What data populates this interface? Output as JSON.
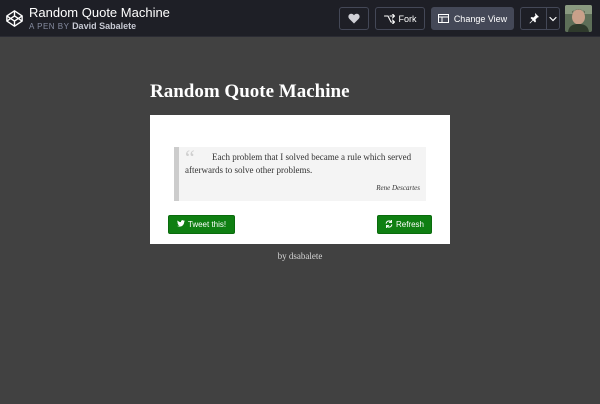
{
  "header": {
    "title": "Random Quote Machine",
    "by_label": "A PEN BY",
    "author": "David Sabalete",
    "fork_label": "Fork",
    "change_view_label": "Change View",
    "icons": {
      "logo": "codepen-logo-icon",
      "heart": "heart-icon",
      "fork": "fork-icon",
      "view": "layout-icon",
      "pin": "pin-icon",
      "caret": "chevron-down-icon"
    }
  },
  "main": {
    "title": "Random Quote Machine",
    "quote": {
      "text": "Each problem that I solved became a rule which served afterwards to solve other problems.",
      "author": "Rene Descartes",
      "mark": "“"
    },
    "tweet_label": "Tweet this!",
    "refresh_label": "Refresh",
    "byline": "by dsabalete"
  },
  "colors": {
    "page_background": "#414141",
    "header_background": "#1e1f26",
    "button_green": "#0f7f12",
    "card_background": "#ffffff"
  }
}
